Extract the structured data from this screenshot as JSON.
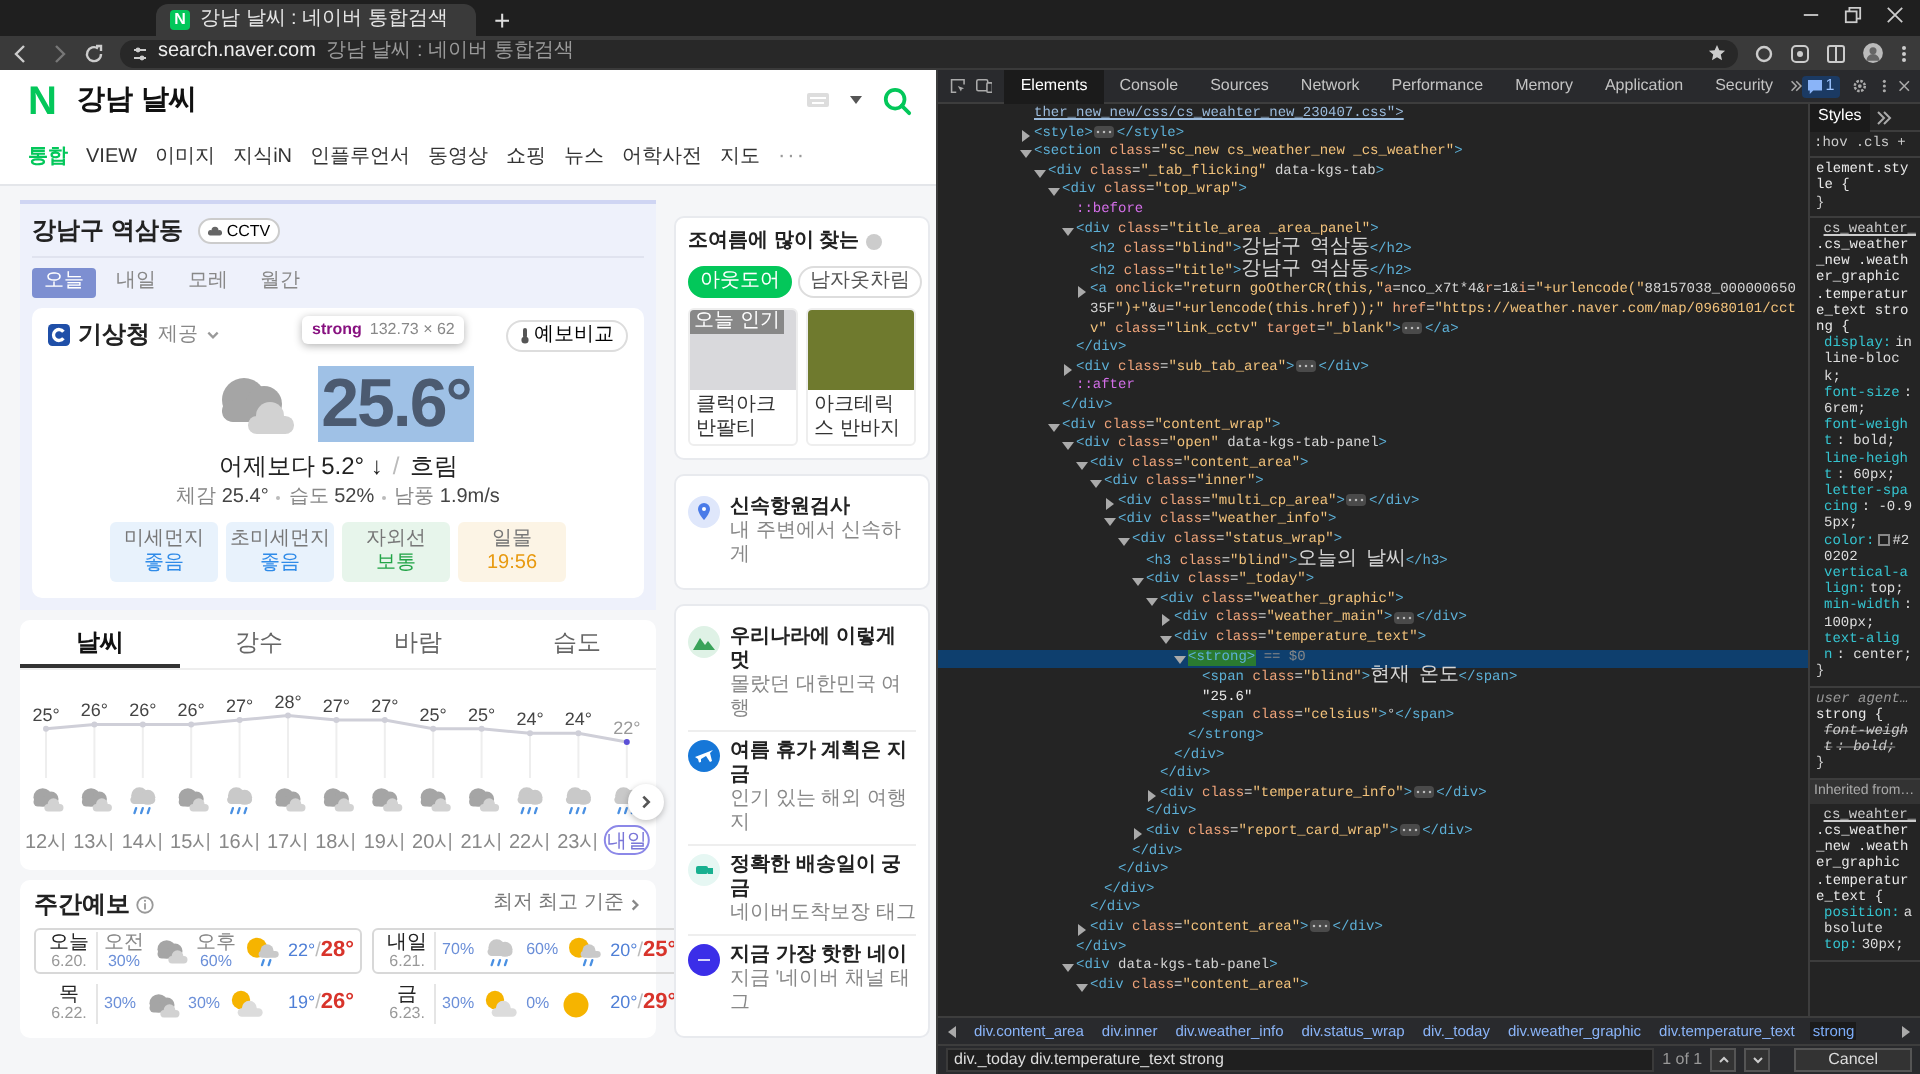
{
  "browser": {
    "tab": {
      "favicon": "N",
      "title": "강남 날씨 : 네이버 통합검색"
    },
    "new_tab": "+",
    "address": {
      "host": "search.naver.com",
      "rest": "강남 날씨 : 네이버 통합검색"
    }
  },
  "naver": {
    "logo": "N",
    "query": "강남 날씨",
    "tabs": [
      {
        "label": "통합",
        "selected": true
      },
      {
        "label": "VIEW",
        "selected": false
      },
      {
        "label": "이미지",
        "selected": false
      },
      {
        "label": "지식iN",
        "selected": false
      },
      {
        "label": "인플루언서",
        "selected": false
      },
      {
        "label": "동영상",
        "selected": false
      },
      {
        "label": "쇼핑",
        "selected": false
      },
      {
        "label": "뉴스",
        "selected": false
      },
      {
        "label": "어학사전",
        "selected": false
      },
      {
        "label": "지도",
        "selected": false
      }
    ],
    "more": "···"
  },
  "weather": {
    "location": "강남구 역삼동",
    "cctv": "CCTV",
    "day_tabs": [
      {
        "label": "오늘",
        "selected": true
      },
      {
        "label": "내일",
        "selected": false
      },
      {
        "label": "모레",
        "selected": false
      },
      {
        "label": "월간",
        "selected": false
      }
    ],
    "provider": {
      "name": "기상청",
      "suffix": "제공"
    },
    "compare_button": "예보비교",
    "tooltip": {
      "tag": "strong",
      "size": "132.73 × 62"
    },
    "current": {
      "kind": "cloudy",
      "temperature": "25.6°",
      "change": "어제보다 5.2° ↓",
      "separator": "/",
      "condition": "흐림"
    },
    "details": [
      {
        "label": "체감",
        "value": "25.4°"
      },
      {
        "label": "습도",
        "value": "52%"
      },
      {
        "label": "남풍",
        "value": "1.9m/s"
      }
    ],
    "reports": [
      {
        "label": "미세먼지",
        "value": "좋음",
        "color": "#2f8be8"
      },
      {
        "label": "초미세먼지",
        "value": "좋음",
        "color": "#2f8be8"
      },
      {
        "label": "자외선",
        "value": "보통",
        "color": "#22a447"
      },
      {
        "label": "일몰",
        "value": "19:56",
        "color": "#e89a10"
      }
    ]
  },
  "hourly": {
    "tabs": [
      {
        "label": "날씨",
        "selected": true
      },
      {
        "label": "강수",
        "selected": false
      },
      {
        "label": "바람",
        "selected": false
      },
      {
        "label": "습도",
        "selected": false
      }
    ],
    "chart_data": {
      "type": "line",
      "grid": true,
      "marker": true,
      "categories": [
        "12시",
        "13시",
        "14시",
        "15시",
        "16시",
        "17시",
        "18시",
        "19시",
        "20시",
        "21시",
        "22시",
        "23시",
        "내일"
      ],
      "values": [
        25,
        26,
        26,
        26,
        27,
        28,
        27,
        27,
        25,
        25,
        24,
        24,
        22
      ],
      "value_labels": [
        "25°",
        "26°",
        "26°",
        "26°",
        "27°",
        "28°",
        "27°",
        "27°",
        "25°",
        "25°",
        "24°",
        "24°",
        "22°"
      ]
    },
    "slots": [
      {
        "kind": "hour",
        "weather": {
          "kind": "cloudy"
        }
      },
      {
        "kind": "hour",
        "weather": {
          "kind": "cloudy"
        }
      },
      {
        "kind": "hour",
        "weather": {
          "kind": "rain"
        }
      },
      {
        "kind": "hour",
        "weather": {
          "kind": "cloudy"
        }
      },
      {
        "kind": "hour",
        "weather": {
          "kind": "rain"
        }
      },
      {
        "kind": "hour",
        "weather": {
          "kind": "cloudy"
        }
      },
      {
        "kind": "hour",
        "weather": {
          "kind": "cloudy"
        }
      },
      {
        "kind": "hour",
        "weather": {
          "kind": "cloudy"
        }
      },
      {
        "kind": "hour",
        "weather": {
          "kind": "cloudy"
        }
      },
      {
        "kind": "hour",
        "weather": {
          "kind": "cloudy"
        }
      },
      {
        "kind": "hour",
        "weather": {
          "kind": "rain"
        }
      },
      {
        "kind": "hour",
        "weather": {
          "kind": "rain"
        }
      },
      {
        "kind": "day",
        "weather": {
          "kind": "rain"
        }
      }
    ]
  },
  "weekly": {
    "title": "주간예보",
    "basis": "최저 최고 기준",
    "days": [
      {
        "kind": "outlined",
        "day": "오늘",
        "date": "6.20.",
        "am": {
          "label": "오전",
          "pop": "30%",
          "kind": "cloudy"
        },
        "pm": {
          "label": "오후",
          "pop": "60%",
          "kind": "sun-rain"
        },
        "low": "22°",
        "sep": "/",
        "high": "28°"
      },
      {
        "kind": "outlined",
        "day": "내일",
        "date": "6.21.",
        "am": {
          "pop": "70%",
          "kind": "rain"
        },
        "pm": {
          "pop": "60%",
          "kind": "sun-rain"
        },
        "low": "20°",
        "sep": "/",
        "high": "25°"
      },
      {
        "kind": "plain",
        "day": "목",
        "date": "6.22.",
        "am": {
          "pop": "30%",
          "kind": "cloudy"
        },
        "pm": {
          "pop": "30%",
          "kind": "partly-sunny"
        },
        "low": "19°",
        "sep": "/",
        "high": "26°"
      },
      {
        "kind": "plain",
        "day": "금",
        "date": "6.23.",
        "am": {
          "pop": "30%",
          "kind": "partly-sunny"
        },
        "pm": {
          "pop": "0%",
          "kind": "sunny"
        },
        "low": "20°",
        "sep": "/",
        "high": "29°"
      }
    ]
  },
  "side": {
    "trend": {
      "title": "조여름에 많이 찾는",
      "chips": [
        {
          "label": "아웃도어",
          "selected": true
        },
        {
          "label": "남자옷차림",
          "selected": false
        }
      ],
      "products": [
        {
          "badge": "오늘 인기",
          "name": "클럭아크반팔티",
          "kind": "shirt"
        },
        {
          "name": "아크테릭스 반바지",
          "kind": "shorts"
        }
      ]
    },
    "promo": {
      "kind": "location",
      "title": "신속항원검사",
      "desc": "내 주변에서 신속하게"
    },
    "links": [
      {
        "kind": "mountain",
        "title": "우리나라에 이렇게 멋",
        "desc": "몰랐던 대한민국 여행"
      },
      {
        "kind": "plane",
        "title": "여름 휴가 계획은 지금",
        "desc": "인기 있는 해외 여행지"
      },
      {
        "kind": "truck",
        "title": "정확한 배송일이 궁금",
        "desc": "네이버도착보장 태그"
      },
      {
        "kind": "channel",
        "title": "지금 가장 핫한 네이",
        "desc": "지금 '네이버 채널 태그"
      }
    ]
  },
  "devtools": {
    "tabs": [
      {
        "label": "Elements",
        "selected": true
      },
      {
        "label": "Console",
        "selected": false
      },
      {
        "label": "Sources",
        "selected": false
      },
      {
        "label": "Network",
        "selected": false
      },
      {
        "label": "Performance",
        "selected": false
      },
      {
        "label": "Memory",
        "selected": false
      },
      {
        "label": "Application",
        "selected": false
      },
      {
        "label": "Security",
        "selected": false
      }
    ],
    "issues": "1",
    "tree": [
      {
        "kind": "fragment",
        "line": "ther_new_new/css/cs_weahter_new_230407.css\">",
        "selected": false
      },
      {
        "kind": "tag",
        "line": "<style>",
        "expanded": false,
        "close": "</style>",
        "selected": false
      },
      {
        "kind": "tag",
        "line": "<section class=\"sc_new cs_weather_new _cs_weather\">",
        "expanded": true,
        "selected": false,
        "children": [
          {
            "kind": "tag",
            "line": "<div class=\"_tab_flicking\" data-kgs-tab>",
            "expanded": true,
            "selected": false,
            "children": [
              {
                "kind": "tag",
                "line": "<div class=\"top_wrap\">",
                "expanded": true,
                "selected": false,
                "close": "</div>",
                "children": [
                  {
                    "kind": "pseudo",
                    "line": "::before",
                    "selected": false
                  },
                  {
                    "kind": "tag",
                    "line": "<div class=\"title_area _area_panel\">",
                    "expanded": true,
                    "selected": false,
                    "close": "</div>",
                    "children": [
                      {
                        "kind": "tag",
                        "line": "<h2 class=\"blind\">강남구 역삼동</h2>",
                        "selected": false
                      },
                      {
                        "kind": "tag",
                        "line": "<h2 class=\"title\">강남구 역삼동</h2>",
                        "selected": false
                      },
                      {
                        "kind": "tag",
                        "line": "<a onclick=\"return goOtherCR(this,\"a=nco_x7t*4&r=1&i=\"+urlencode(\"88157038_00000065035F\")+\"&u=\"+urlencode(this.href));\" href=\"https://weather.naver.com/map/09680101/cctv\" class=\"link_cctv\" target=\"_blank\">",
                        "expanded": false,
                        "close": "</a>",
                        "selected": false
                      }
                    ]
                  },
                  {
                    "kind": "tag",
                    "line": "<div class=\"sub_tab_area\">",
                    "expanded": false,
                    "close": "</div>",
                    "selected": false
                  },
                  {
                    "kind": "pseudo",
                    "line": "::after",
                    "selected": false
                  }
                ]
              },
              {
                "kind": "tag",
                "line": "<div class=\"content_wrap\">",
                "expanded": true,
                "selected": false,
                "children": [
                  {
                    "kind": "tag",
                    "line": "<div class=\"open\" data-kgs-tab-panel>",
                    "expanded": true,
                    "selected": false,
                    "close": "</div>",
                    "children": [
                      {
                        "kind": "tag",
                        "line": "<div class=\"content_area\">",
                        "expanded": true,
                        "selected": false,
                        "close": "</div>",
                        "children": [
                          {
                            "kind": "tag",
                            "line": "<div class=\"inner\">",
                            "expanded": true,
                            "selected": false,
                            "close": "</div>",
                            "children": [
                              {
                                "kind": "tag",
                                "line": "<div class=\"multi_cp_area\">",
                                "expanded": false,
                                "close": "</div>",
                                "selected": false
                              },
                              {
                                "kind": "tag",
                                "line": "<div class=\"weather_info\">",
                                "expanded": true,
                                "selected": false,
                                "close": "</div>",
                                "children": [
                                  {
                                    "kind": "tag",
                                    "line": "<div class=\"status_wrap\">",
                                    "expanded": true,
                                    "selected": false,
                                    "close": "</div>",
                                    "children": [
                                      {
                                        "kind": "tag",
                                        "line": "<h3 class=\"blind\">오늘의 날씨</h3>",
                                        "selected": false
                                      },
                                      {
                                        "kind": "tag",
                                        "line": "<div class=\"_today\">",
                                        "expanded": true,
                                        "selected": false,
                                        "close": "</div>",
                                        "children": [
                                          {
                                            "kind": "tag",
                                            "line": "<div class=\"weather_graphic\">",
                                            "expanded": true,
                                            "selected": false,
                                            "close": "</div>",
                                            "children": [
                                              {
                                                "kind": "tag",
                                                "line": "<div class=\"weather_main\">",
                                                "expanded": false,
                                                "close": "</div>",
                                                "selected": false
                                              },
                                              {
                                                "kind": "tag",
                                                "line": "<div class=\"temperature_text\">",
                                                "expanded": true,
                                                "selected": false,
                                                "close": "</div>",
                                                "children": [
                                                  {
                                                    "kind": "tag",
                                                    "line": "<strong>",
                                                    "suffix": "== $0",
                                                    "expanded": true,
                                                    "selected": true,
                                                    "close": "</strong>",
                                                    "children": [
                                                      {
                                                        "kind": "tag",
                                                        "line": "<span class=\"blind\">현재 온도</span>",
                                                        "selected": false
                                                      },
                                                      {
                                                        "kind": "text",
                                                        "line": "\"25.6\"",
                                                        "selected": false
                                                      },
                                                      {
                                                        "kind": "tag",
                                                        "line": "<span class=\"celsius\">°</span>",
                                                        "selected": false
                                                      }
                                                    ]
                                                  }
                                                ]
                                              }
                                            ]
                                          },
                                          {
                                            "kind": "tag",
                                            "line": "<div class=\"temperature_info\">",
                                            "expanded": false,
                                            "close": "</div>",
                                            "selected": false
                                          }
                                        ]
                                      },
                                      {
                                        "kind": "tag",
                                        "line": "<div class=\"report_card_wrap\">",
                                        "expanded": false,
                                        "close": "</div>",
                                        "selected": false
                                      }
                                    ]
                                  }
                                ]
                              }
                            ]
                          }
                        ]
                      },
                      {
                        "kind": "tag",
                        "line": "<div class=\"content_area\">",
                        "expanded": false,
                        "close": "</div>",
                        "selected": false
                      }
                    ]
                  },
                  {
                    "kind": "tag",
                    "line": "<div data-kgs-tab-panel>",
                    "expanded": true,
                    "selected": false,
                    "children": [
                      {
                        "kind": "tag",
                        "line": "<div class=\"content_area\">",
                        "expanded": true,
                        "selected": false
                      }
                    ]
                  }
                ]
              }
            ]
          }
        ]
      }
    ],
    "styles": {
      "tab": "Styles",
      "filters": [
        ":hov",
        ".cls"
      ],
      "add": "+",
      "rules": [
        {
          "selector": "element.style {",
          "close": "}"
        },
        {
          "source": "cs_weahter_",
          "kind": "link",
          "selector": ".cs_weather_new .weather_graphic .temperature_text strong {",
          "props": [
            {
              "name": "display:",
              "value": "inline-block;",
              "overridden": false
            },
            {
              "name": "font-size",
              "value": ": 6rem;",
              "overridden": false
            },
            {
              "name": "font-weight",
              "value": ": bold;",
              "overridden": false
            },
            {
              "name": "line-height",
              "value": ": 60px;",
              "overridden": false
            },
            {
              "name": "letter-spacing",
              "value": ": -0.95px;",
              "overridden": false
            },
            {
              "name": "color:",
              "value": "#20202",
              "overridden": false,
              "color": "#202020"
            },
            {
              "name": "vertical-align:",
              "value": "top;",
              "overridden": false
            },
            {
              "name": "min-width",
              "value": ": 100px;",
              "overridden": false
            },
            {
              "name": "text-align",
              "value": ": center;",
              "overridden": false
            }
          ],
          "close": "}"
        },
        {
          "source": "user agent…",
          "kind": "builtin",
          "selector": "strong {",
          "props": [
            {
              "name": "font-weight",
              "value": ": bold;",
              "overridden": true
            }
          ],
          "close": "}"
        },
        {
          "heading": "Inherited from…",
          "source": "cs_weahter_",
          "kind": "link",
          "selector": ".cs_weather_new .weather_graphic .temperature_text {",
          "props": [
            {
              "name": "position:",
              "value": "absolute",
              "overridden": false
            },
            {
              "name": "top:",
              "value": "30px;",
              "overridden": false
            }
          ]
        }
      ]
    },
    "breadcrumbs": [
      {
        "label": "div.content_area",
        "selected": false
      },
      {
        "label": "div.inner",
        "selected": false
      },
      {
        "label": "div.weather_info",
        "selected": false
      },
      {
        "label": "div.status_wrap",
        "selected": false
      },
      {
        "label": "div._today",
        "selected": false
      },
      {
        "label": "div.weather_graphic",
        "selected": false
      },
      {
        "label": "div.temperature_text",
        "selected": false
      },
      {
        "label": "strong",
        "selected": true
      }
    ],
    "search": {
      "value": "div._today div.temperature_text strong",
      "count": "1 of 1",
      "cancel": "Cancel"
    }
  }
}
